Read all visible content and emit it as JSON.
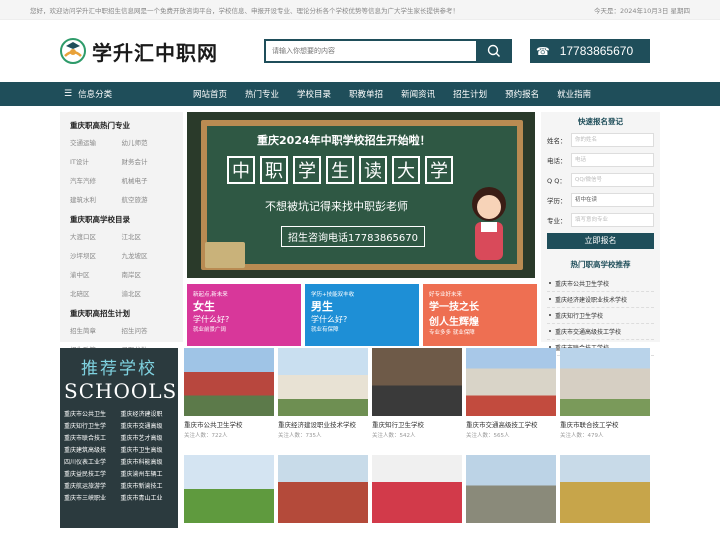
{
  "topbar": {
    "welcome": "您好，欢迎访问学升汇中职招生信息网是一个免费开放咨询平台，学校信息、申报开设专业、理论分析各个学校优势等信息为广大学生家长提供参考！",
    "date": "今天是：2024年10月3日 星期四"
  },
  "header": {
    "site_name": "学升汇中职网",
    "search_placeholder": "请输入你想要的内容",
    "phone": "17783865670"
  },
  "nav": {
    "category_label": "信息分类",
    "items": [
      "网站首页",
      "热门专业",
      "学校目录",
      "职教单招",
      "新闻资讯",
      "招生计划",
      "预约报名",
      "就业指南"
    ]
  },
  "sidebar": {
    "sections": [
      {
        "title": "重庆职高热门专业",
        "items": [
          "交通运输",
          "幼儿师范",
          "IT设计",
          "财务会计",
          "汽车汽修",
          "机械电子",
          "建筑水利",
          "航空旅游"
        ]
      },
      {
        "title": "重庆职高学校目录",
        "items": [
          "大渡口区",
          "江北区",
          "沙坪坝区",
          "九龙坡区",
          "渝中区",
          "南岸区",
          "北碚区",
          "渝北区"
        ]
      },
      {
        "title": "重庆职高招生计划",
        "items": [
          "招生简章",
          "招生问答",
          "招生政策",
          "录取分数"
        ]
      }
    ]
  },
  "banner": {
    "headline": "重庆2024年中职学校招生开始啦！",
    "chars": [
      "中",
      "职",
      "学",
      "生",
      "读",
      "大",
      "学"
    ],
    "slogan": "不想被坑记得来找中职彭老师",
    "contact": "招生咨询电话17783865670"
  },
  "thumbs": [
    {
      "line1": "新起点,新未来",
      "line2": "女生",
      "line3": "学什么好?",
      "line4": "就业前景广阔",
      "color": "#d8379a"
    },
    {
      "line1": "学历+技能双丰收",
      "line2": "男生",
      "line3": "学什么好?",
      "line4": "就业有保障",
      "color": "#1e8fd6"
    },
    {
      "line1": "好专业好未来",
      "line2": "学一技之长",
      "line3": "创人生辉煌",
      "line4": "专业多多 就业保障",
      "color": "#ee6f52"
    }
  ],
  "form": {
    "title": "快速报名登记",
    "fields": [
      {
        "label": "姓名：",
        "placeholder": "你的姓名"
      },
      {
        "label": "电话：",
        "placeholder": "电话"
      },
      {
        "label": "Q Q：",
        "placeholder": "QQ/微信号"
      },
      {
        "label": "学历：",
        "placeholder": "初中在读"
      },
      {
        "label": "专业：",
        "placeholder": "填写意向专业"
      }
    ],
    "submit": "立即报名"
  },
  "hot": {
    "title": "热门职高学校推荐",
    "items": [
      "重庆市公共卫生学校",
      "重庆经济建设职业技术学校",
      "重庆知行卫生学校",
      "重庆市交通高级技工学校",
      "重庆市联合技工学校"
    ]
  },
  "schools_box": {
    "title_cn": "推荐学校",
    "title_en": "SCHOOLS",
    "items": [
      "重庆市公共卫生",
      "重庆经济建设职",
      "重庆知行卫生学",
      "重庆市交通高级",
      "重庆市联合技工",
      "重庆市艺才高级",
      "重庆建筑高级技",
      "重庆市卫生高级",
      "四川仪表工业学",
      "重庆市科能高级",
      "重庆益民技工学",
      "重庆渝州车辆工",
      "重庆航运旅游学",
      "重庆市新渝技工",
      "重庆市三峡职业",
      "重庆市青山工业"
    ]
  },
  "cards": [
    {
      "name": "重庆市公共卫生学校",
      "count": "关注人数：722人"
    },
    {
      "name": "重庆经济建设职业技术学校",
      "count": "关注人数：735人"
    },
    {
      "name": "重庆知行卫生学校",
      "count": "关注人数：542人"
    },
    {
      "name": "重庆市交通高级技工学校",
      "count": "关注人数：565人"
    },
    {
      "name": "重庆市联合技工学校",
      "count": "关注人数：479人"
    }
  ]
}
